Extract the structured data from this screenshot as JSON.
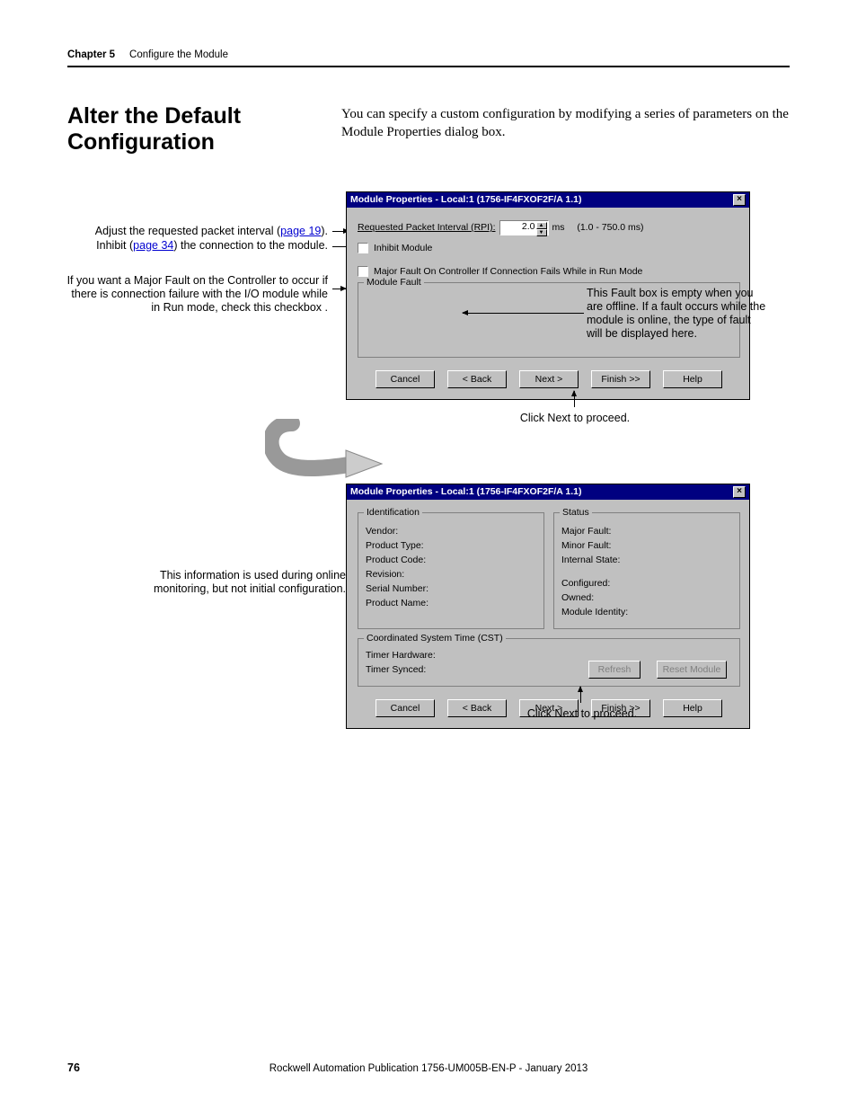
{
  "header": {
    "chapter": "Chapter 5",
    "title": "Configure the Module"
  },
  "section_heading": "Alter the Default Configuration",
  "intro": "You can specify a custom configuration by modifying a series of parameters on the Module Properties dialog box.",
  "callouts": {
    "rpi_a": "Adjust the requested packet interval (",
    "rpi_link": "page 19",
    "rpi_b": ").",
    "inhibit_a": "Inhibit (",
    "inhibit_link": "page 34",
    "inhibit_b": ") the connection to the module.",
    "major_fault": "If you want a Major Fault on the Controller to occur if there is connection failure with the I/O module while in Run mode, check this checkbox .",
    "fault_box": "This Fault box is empty when you are offline. If a fault occurs while the module is online, the type of fault will be displayed here.",
    "online_info": "This information is used during online monitoring, but not initial configuration.",
    "click_next": "Click Next to proceed."
  },
  "dialog1": {
    "title": "Module Properties - Local:1 (1756-IF4FXOF2F/A 1.1)",
    "rpi_label": "Requested Packet Interval (RPI):",
    "rpi_value": "2.0",
    "rpi_unit": "ms",
    "rpi_range": "(1.0 - 750.0 ms)",
    "inhibit": "Inhibit Module",
    "major_fault_chk": "Major Fault On Controller If Connection Fails While in Run Mode",
    "module_fault_group": "Module Fault",
    "buttons": {
      "cancel": "Cancel",
      "back": "< Back",
      "next": "Next >",
      "finish": "Finish >>",
      "help": "Help"
    }
  },
  "dialog2": {
    "title": "Module Properties - Local:1 (1756-IF4FXOF2F/A 1.1)",
    "identification": {
      "group": "Identification",
      "vendor": "Vendor:",
      "product_type": "Product Type:",
      "product_code": "Product Code:",
      "revision": "Revision:",
      "serial": "Serial Number:",
      "product_name": "Product Name:"
    },
    "status": {
      "group": "Status",
      "major_fault": "Major Fault:",
      "minor_fault": "Minor Fault:",
      "internal_state": "Internal State:",
      "configured": "Configured:",
      "owned": "Owned:",
      "module_identity": "Module Identity:"
    },
    "cst": {
      "group": "Coordinated System Time (CST)",
      "timer_hw": "Timer Hardware:",
      "timer_sync": "Timer Synced:",
      "refresh": "Refresh",
      "reset": "Reset Module"
    },
    "buttons": {
      "cancel": "Cancel",
      "back": "< Back",
      "next": "Next >",
      "finish": "Finish >>",
      "help": "Help"
    }
  },
  "footer": {
    "pagenum": "76",
    "pub": "Rockwell Automation Publication 1756-UM005B-EN-P - January 2013"
  }
}
